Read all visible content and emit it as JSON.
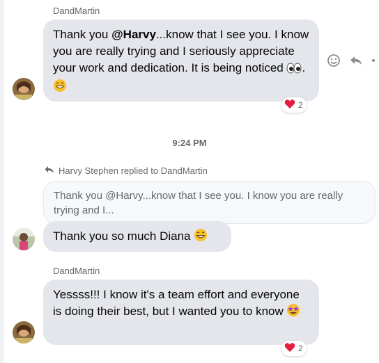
{
  "messages": [
    {
      "sender": "DandMartin",
      "text_before": "Thank you ",
      "mention": "@Harvy",
      "text_after": "...know that I see you. I know you are really trying and I seriously appreciate your work and dedication. It is being noticed ",
      "text_end": ". ",
      "reaction": {
        "emoji": "heart",
        "count": "2"
      }
    },
    {
      "reply_header": "Harvy Stephen replied to DandMartin",
      "quoted_text": "Thank you @Harvy...know that I see you. I know you are really trying and I...",
      "text": "Thank you so much Diana "
    },
    {
      "sender": "DandMartin",
      "text": "Yessss!!! I know it's a team effort and everyone is doing their best, but I wanted you to know ",
      "reaction": {
        "emoji": "heart",
        "count": "2"
      }
    }
  ],
  "timestamp": "9:24 PM",
  "icons": {
    "smiley": "smiley-icon",
    "reply": "reply-icon",
    "more": "more-options-icon",
    "eyes": "eyes-emoji",
    "grin": "grinning-emoji",
    "star_struck": "star-struck-emoji",
    "heart": "heart-emoji"
  },
  "colors": {
    "bubble": "#e4e6eb",
    "meta_text": "#65676b",
    "heart": "#e41e3f"
  }
}
